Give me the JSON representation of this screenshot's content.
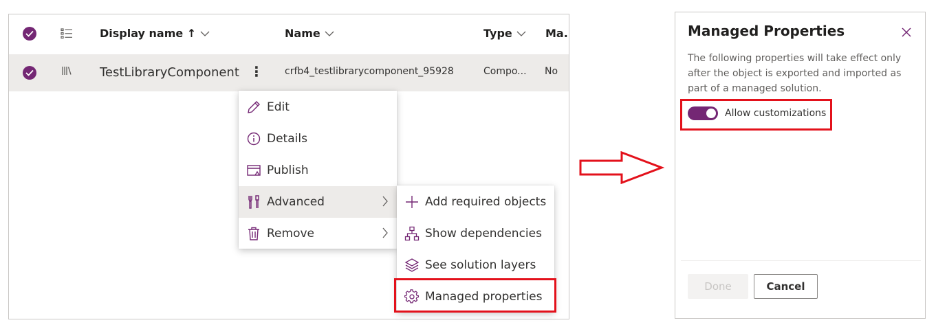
{
  "grid": {
    "columns": {
      "display_name": "Display name ↑",
      "name": "Name",
      "type": "Type",
      "managed": "Ma..."
    },
    "row": {
      "display_name": "TestLibraryComponent",
      "more_glyph": "⋮",
      "name": "crfb4_testlibrarycomponent_95928",
      "type": "Compo...",
      "managed": "No"
    }
  },
  "context_menu": {
    "items": [
      {
        "label": "Edit",
        "icon": "pencil-icon"
      },
      {
        "label": "Details",
        "icon": "info-icon"
      },
      {
        "label": "Publish",
        "icon": "publish-icon"
      },
      {
        "label": "Advanced",
        "icon": "tools-icon",
        "submenu": true
      },
      {
        "label": "Remove",
        "icon": "trash-icon",
        "submenu": true
      }
    ]
  },
  "sub_menu": {
    "items": [
      {
        "label": "Add required objects",
        "icon": "plus-icon"
      },
      {
        "label": "Show dependencies",
        "icon": "hierarchy-icon"
      },
      {
        "label": "See solution layers",
        "icon": "layers-icon"
      },
      {
        "label": "Managed properties",
        "icon": "gear-icon"
      }
    ]
  },
  "panel": {
    "title": "Managed Properties",
    "description": "The following properties will take effect only after the object is exported and imported as part of a managed solution.",
    "toggle_label": "Allow customizations",
    "toggle_on": true,
    "done_label": "Done",
    "cancel_label": "Cancel"
  },
  "colors": {
    "accent": "#742774",
    "highlight": "#e3111b",
    "row_selected": "#edebe9"
  }
}
